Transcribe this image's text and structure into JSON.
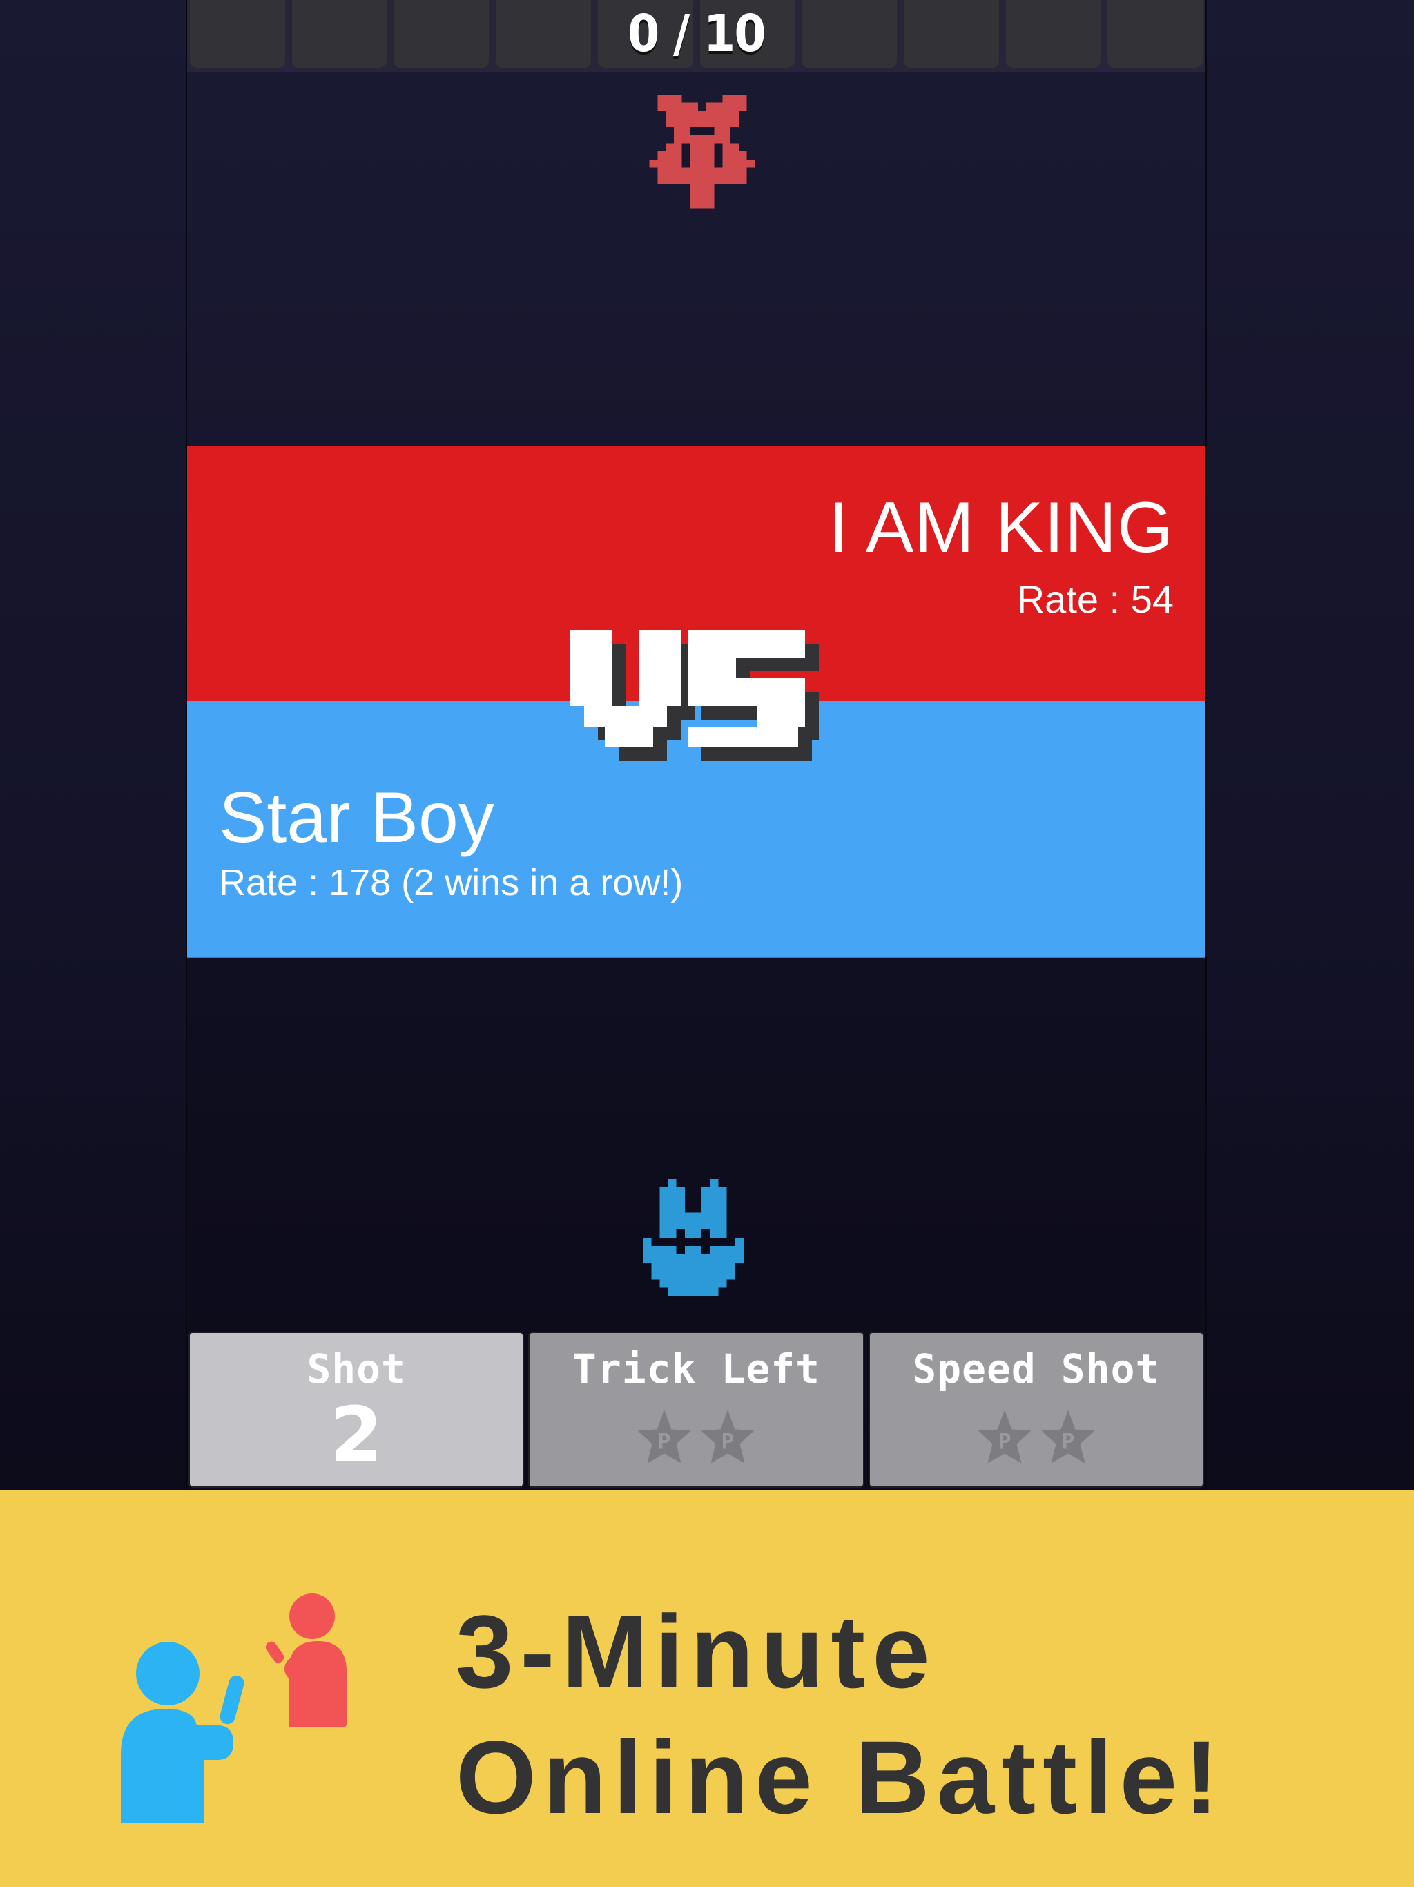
{
  "progress": {
    "label": "0 / 10",
    "current": 0,
    "total": 10
  },
  "opponent": {
    "name": "I AM KING",
    "rate_text": "Rate : 54",
    "rate": 54,
    "color": "#dc1c1e",
    "sprite_icon": "red-pixel-star-enemy"
  },
  "player": {
    "name": "Star Boy",
    "rate_text": "Rate : 178 (2 wins in a row!)",
    "rate": 178,
    "streak": 2,
    "color": "#47a5f5",
    "sprite_icon": "blue-pixel-ship-player"
  },
  "versus_label": "VS",
  "hud": {
    "shot": {
      "label": "Shot",
      "value": "2"
    },
    "trick_left": {
      "label": "Trick Left",
      "stars": [
        "P",
        "P"
      ]
    },
    "speed_shot": {
      "label": "Speed Shot",
      "stars": [
        "P",
        "P"
      ]
    }
  },
  "promo": {
    "line1": "3-Minute",
    "line2": "Online Battle!",
    "icon": "two-players-icon",
    "background": "#f3cd4f"
  }
}
